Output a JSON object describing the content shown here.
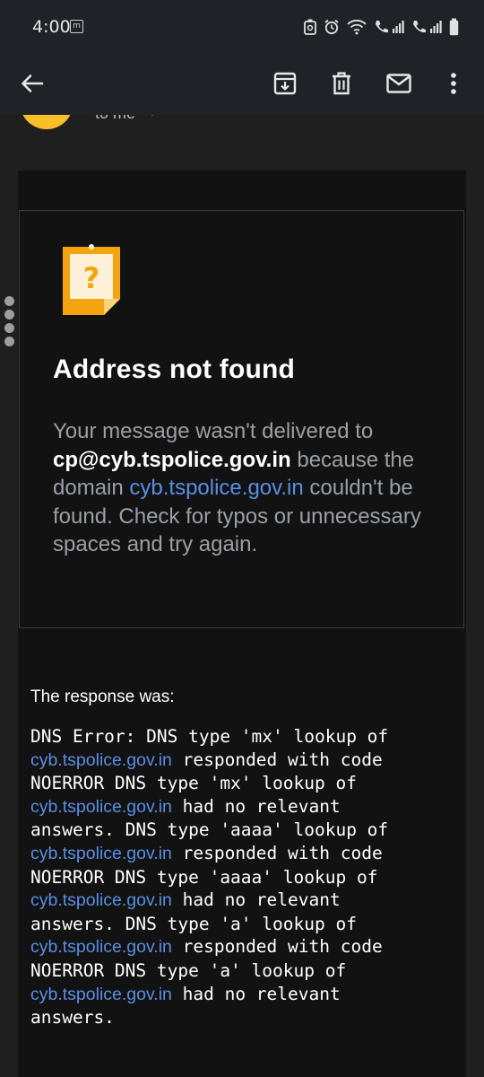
{
  "status_bar": {
    "time": "4:00",
    "notification_icon": "m-icon"
  },
  "app_bar": {
    "icons": [
      "back-arrow-icon",
      "archive-icon",
      "delete-icon",
      "mark-unread-icon",
      "more-vert-icon"
    ]
  },
  "header": {
    "to_me": "to me",
    "caret": "˅",
    "avatar_color": "#f6bf26"
  },
  "card": {
    "title": "Address not found",
    "msg_intro": "Your message wasn't delivered to ",
    "recipient": "cp@cyb.tspolice.gov.in",
    "msg_because": " because the domain ",
    "domain_link": "cyb.tspolice.gov.in",
    "msg_outro": " couldn't be found. Check for typos or unnecessary spaces and try again."
  },
  "response": {
    "label": "The response was:",
    "domain": "cyb.tspolice.gov.in",
    "line_1": "DNS Error: DNS type 'mx' lookup of",
    "tail_responded": " responded with code",
    "line_noerror_mx": "NOERROR DNS type 'mx' lookup of",
    "tail_no_relevant": " had no relevant",
    "line_answers_aaaa": "answers. DNS type 'aaaa' lookup of",
    "line_noerror_aaaa": "NOERROR DNS type 'aaaa' lookup of",
    "line_answers_a": "answers. DNS type 'a' lookup of",
    "line_noerror_a": "NOERROR DNS type 'a' lookup of",
    "line_last": "answers."
  },
  "colors": {
    "link": "#5a8fe6",
    "panel": "#121212",
    "bar": "#1f2227"
  }
}
